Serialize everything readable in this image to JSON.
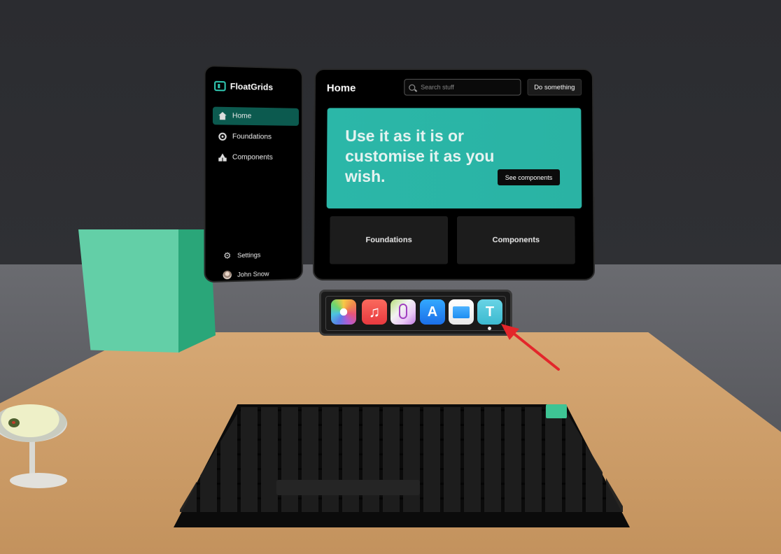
{
  "sidebar": {
    "brand": "FloatGrids",
    "nav": [
      {
        "label": "Home",
        "icon": "home-icon",
        "active": true
      },
      {
        "label": "Foundations",
        "icon": "foundations-icon",
        "active": false
      },
      {
        "label": "Components",
        "icon": "components-icon",
        "active": false
      }
    ],
    "settings_label": "Settings",
    "user_name": "John Snow"
  },
  "main": {
    "title": "Home",
    "search_placeholder": "Search stuff",
    "action_button": "Do something",
    "hero": {
      "text": "Use it as it is or customise it as you wish.",
      "button": "See components"
    },
    "cards": [
      "Foundations",
      "Components"
    ]
  },
  "dock": {
    "apps": [
      "photos-app-icon",
      "music-app-icon",
      "maps-app-icon",
      "app-store-icon",
      "files-app-icon",
      "floatgrids-t-app-icon"
    ],
    "t_app_letter": "T",
    "active_app": "floatgrids-t-app-icon"
  },
  "colors": {
    "accent": "#2bb7a8",
    "active_nav": "#0c5a4f",
    "panel": "#000000",
    "arrow": "#e3262b"
  }
}
